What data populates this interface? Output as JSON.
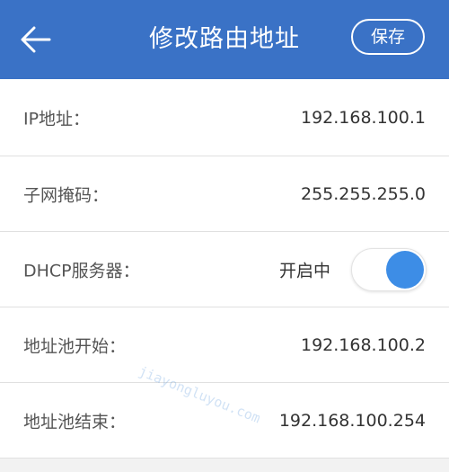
{
  "header": {
    "title": "修改路由地址",
    "save_label": "保存",
    "back_icon": "arrow-left-icon"
  },
  "rows": [
    {
      "label": "IP地址：",
      "value": "192.168.100.1"
    },
    {
      "label": "子网掩码：",
      "value": "255.255.255.0"
    },
    {
      "label": "DHCP服务器：",
      "value": "开启中",
      "toggle_on": true
    },
    {
      "label": "地址池开始：",
      "value": "192.168.100.2"
    },
    {
      "label": "地址池结束：",
      "value": "192.168.100.254"
    }
  ],
  "colors": {
    "header_bg": "#3a72c6",
    "toggle_knob": "#3d8de6",
    "background": "#f2f2f2"
  },
  "watermark": "jiayongluyou.com"
}
